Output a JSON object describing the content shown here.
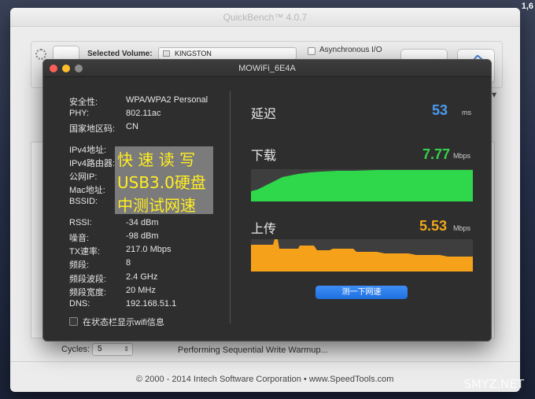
{
  "screen": {
    "corner_text": "1,6"
  },
  "quickbench": {
    "title": "QuickBench™ 4.0.7",
    "selected_volume_label": "Selected Volume:",
    "selected_volume_value": "KINGSTON",
    "async_label": "Asynchronous I/O",
    "cycles_label": "Cycles:",
    "cycles_value": "5",
    "status": "Performing Sequential Write Warmup...",
    "copyright": "© 2000 - 2014 Intech Software Corporation • www.SpeedTools.com"
  },
  "wifi": {
    "title": "MOWiFi_6E4A",
    "info_rows_top": [
      {
        "label": "安全性:",
        "value": "WPA/WPA2 Personal"
      },
      {
        "label": "PHY:",
        "value": "802.11ac"
      },
      {
        "label": "国家地区码:",
        "value": "CN"
      }
    ],
    "info_rows_network": [
      {
        "label": "IPv4地址:"
      },
      {
        "label": "IPv4路由器:"
      },
      {
        "label": "公网IP:"
      },
      {
        "label": "Mac地址:"
      },
      {
        "label": "BSSID:"
      }
    ],
    "info_rows_bottom": [
      {
        "label": "RSSI:",
        "value": "-34 dBm"
      },
      {
        "label": "噪音:",
        "value": "-98 dBm"
      },
      {
        "label": "TX速率:",
        "value": "217.0 Mbps"
      },
      {
        "label": "频段:",
        "value": "8"
      },
      {
        "label": "频段波段:",
        "value": "2.4 GHz"
      },
      {
        "label": "频段宽度:",
        "value": "20 MHz"
      },
      {
        "label": "DNS:",
        "value": "192.168.51.1"
      }
    ],
    "overlay_lines": [
      "快 速 读 写",
      "USB3.0硬盘",
      "中测试网速"
    ],
    "status_bar_checkbox_label": "在状态栏显示wifi信息",
    "latency": {
      "label": "延迟",
      "value": "53",
      "unit": "ms",
      "color": "#4a9cf0"
    },
    "download": {
      "label": "下载",
      "value": "7.77",
      "unit": "Mbps",
      "color": "#36d04a",
      "fill_color": "#2fd84a"
    },
    "upload": {
      "label": "上传",
      "value": "5.53",
      "unit": "Mbps",
      "color": "#f0a81c",
      "fill_color": "#f5a21a"
    },
    "test_button_label": "测一下网速"
  },
  "watermark": "SMYZ.NET"
}
